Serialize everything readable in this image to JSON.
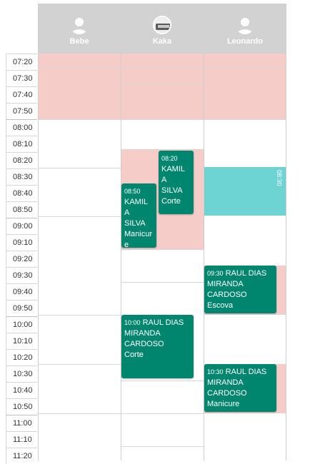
{
  "staff": [
    {
      "name": "Bebe",
      "avatar": "user-silhouette-icon"
    },
    {
      "name": "Kaka",
      "avatar": "photo-avatar"
    },
    {
      "name": "Leonardo",
      "avatar": "user-silhouette-icon"
    }
  ],
  "times": [
    "07:20",
    "07:30",
    "07:40",
    "07:50",
    "08:00",
    "08:10",
    "08:20",
    "08:30",
    "08:40",
    "08:50",
    "09:00",
    "09:10",
    "09:20",
    "09:30",
    "09:40",
    "09:50",
    "10:00",
    "10:10",
    "10:20",
    "10:30",
    "10:40",
    "10:50",
    "11:00",
    "11:10",
    "11:20"
  ],
  "appointments": [
    {
      "id": "a1",
      "time": "08:20",
      "lines": [
        "KAMIL",
        "A",
        "SILVA",
        "Corte"
      ]
    },
    {
      "id": "a2",
      "time": "08:50",
      "lines": [
        "KAMIL",
        "A",
        "SILVA",
        "Manicur",
        "e"
      ]
    },
    {
      "id": "a3",
      "time": "09:30",
      "lines": [
        "RAUL DIAS",
        "MIRANDA",
        "CARDOSO",
        "Escova"
      ]
    },
    {
      "id": "a4",
      "time": "10:00",
      "lines": [
        "RAUL DIAS",
        "MIRANDA",
        "CARDOSO",
        "Corte"
      ]
    },
    {
      "id": "a5",
      "time": "10:30",
      "lines": [
        "RAUL DIAS",
        "MIRANDA",
        "CARDOSO",
        "Manicure"
      ]
    }
  ],
  "blocked": {
    "time": "08:30"
  },
  "colors": {
    "pink": "#f6ccc8",
    "teal_dark": "#00856f",
    "teal_light": "#6dd4d3",
    "header": "#d2d2d2"
  }
}
